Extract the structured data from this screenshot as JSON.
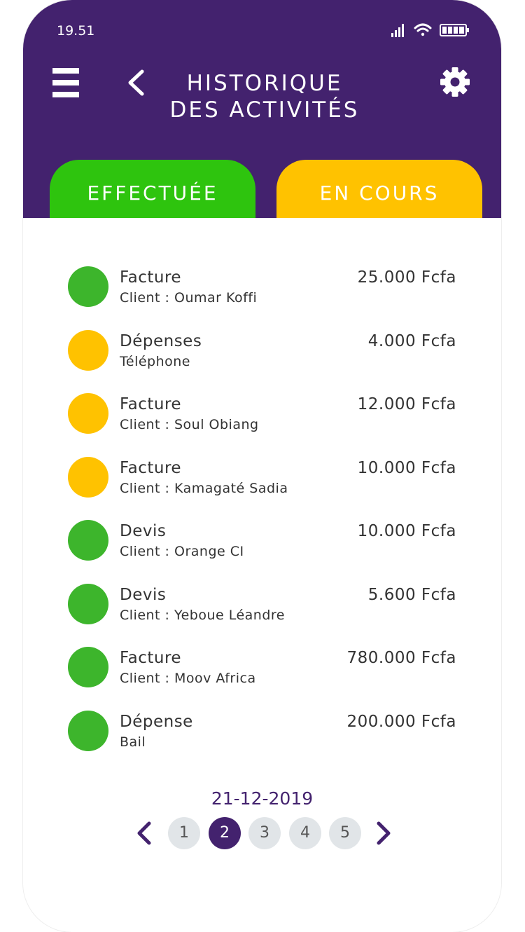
{
  "status_bar": {
    "time": "19.51"
  },
  "header": {
    "title_line1": "HISTORIQUE",
    "title_line2": "DES ACTIVITÉS"
  },
  "tabs": [
    {
      "label": "EFFECTUÉE",
      "color": "#2ec40e"
    },
    {
      "label": "EN COURS",
      "color": "#ffc200"
    }
  ],
  "colors": {
    "header": "#43226e",
    "done": "#2ec40e",
    "pending": "#ffc200",
    "page_inactive": "#e1e5e8"
  },
  "activities": [
    {
      "title": "Facture",
      "subtitle": "Client : Oumar Koffi",
      "amount": "25.000 Fcfa",
      "status": "done"
    },
    {
      "title": "Dépenses",
      "subtitle": "Téléphone",
      "amount": "4.000 Fcfa",
      "status": "pending"
    },
    {
      "title": "Facture",
      "subtitle": "Client : Soul Obiang",
      "amount": "12.000 Fcfa",
      "status": "pending"
    },
    {
      "title": "Facture",
      "subtitle": "Client : Kamagaté Sadia",
      "amount": "10.000 Fcfa",
      "status": "pending"
    },
    {
      "title": "Devis",
      "subtitle": "Client : Orange CI",
      "amount": "10.000 Fcfa",
      "status": "done"
    },
    {
      "title": "Devis",
      "subtitle": "Client : Yeboue Léandre",
      "amount": "5.600 Fcfa",
      "status": "done"
    },
    {
      "title": "Facture",
      "subtitle": "Client : Moov Africa",
      "amount": "780.000 Fcfa",
      "status": "done"
    },
    {
      "title": "Dépense",
      "subtitle": "Bail",
      "amount": "200.000 Fcfa",
      "status": "done"
    }
  ],
  "date": "21-12-2019",
  "pagination": {
    "pages": [
      "1",
      "2",
      "3",
      "4",
      "5"
    ],
    "current": "2"
  },
  "icons": {
    "menu": "menu-icon",
    "back": "chevron-left-icon",
    "settings": "gear-icon",
    "signal": "signal-icon",
    "wifi": "wifi-icon",
    "battery": "battery-icon",
    "prev": "chevron-left-icon",
    "next": "chevron-right-icon"
  }
}
